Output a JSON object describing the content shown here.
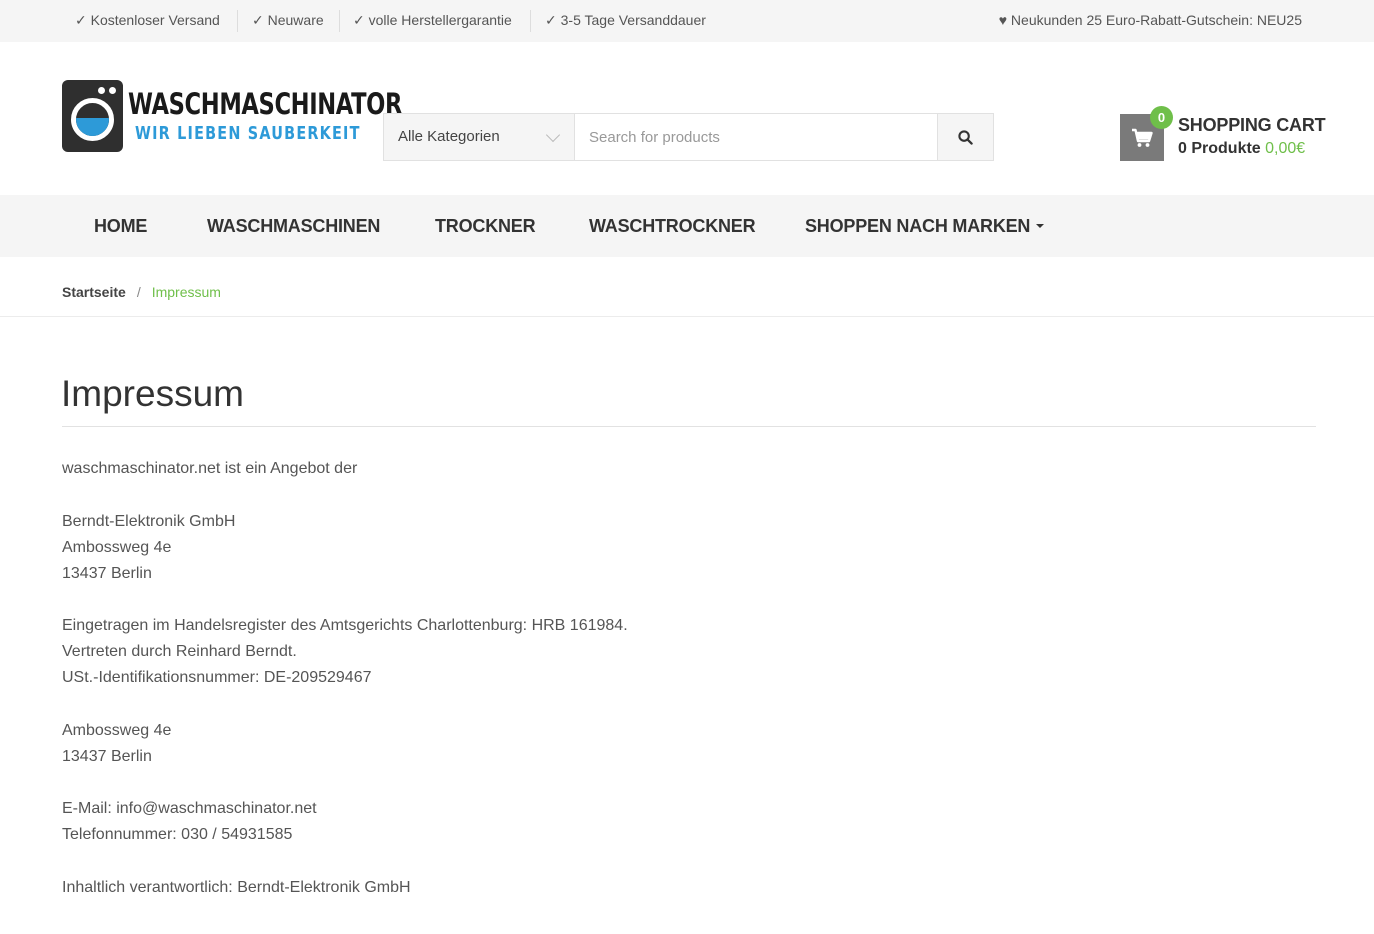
{
  "topbar": {
    "usps": [
      "✓ Kostenloser Versand",
      "✓ Neuware",
      "✓ volle Herstellergarantie",
      "✓ 3-5 Tage Versanddauer"
    ],
    "promo": "♥ Neukunden 25 Euro-Rabatt-Gutschein: NEU25"
  },
  "logo": {
    "title": "WASCHMASCHINATOR",
    "subtitle": "WIR LIEBEN SAUBERKEIT"
  },
  "search": {
    "category": "Alle Kategorien",
    "placeholder": "Search for products",
    "value": ""
  },
  "cart": {
    "count": "0",
    "title": "SHOPPING CART",
    "products": "0 Produkte",
    "total": "0,00€"
  },
  "nav": {
    "items": [
      "HOME",
      "WASCHMASCHINEN",
      "TROCKNER",
      "WASCHTROCKNER",
      "SHOPPEN NACH MARKEN"
    ]
  },
  "breadcrumb": {
    "home": "Startseite",
    "separator": "/",
    "current": "Impressum"
  },
  "page": {
    "title": "Impressum",
    "lines": [
      "waschmaschinator.net ist ein Angebot der",
      "",
      "Berndt-Elektronik GmbH",
      "Ambossweg 4e",
      "13437 Berlin",
      "",
      "Eingetragen im Handelsregister des Amtsgerichts Charlottenburg: HRB 161984.",
      "Vertreten durch Reinhard Berndt.",
      "USt.-Identifikationsnummer: DE-209529467",
      "",
      "Ambossweg 4e",
      "13437 Berlin",
      "",
      "E-Mail: info@waschmaschinator.net",
      "Telefonnummer: 030 / 54931585",
      "",
      "Inhaltlich verantwortlich: Berndt-Elektronik GmbH"
    ]
  },
  "colors": {
    "accent_green": "#6fbf4a",
    "logo_blue": "#2d9ad8",
    "bar_gray": "#f5f5f5"
  },
  "icons": {
    "search": "search-icon",
    "cart": "cart-icon",
    "caret": "chevron-down-icon"
  }
}
